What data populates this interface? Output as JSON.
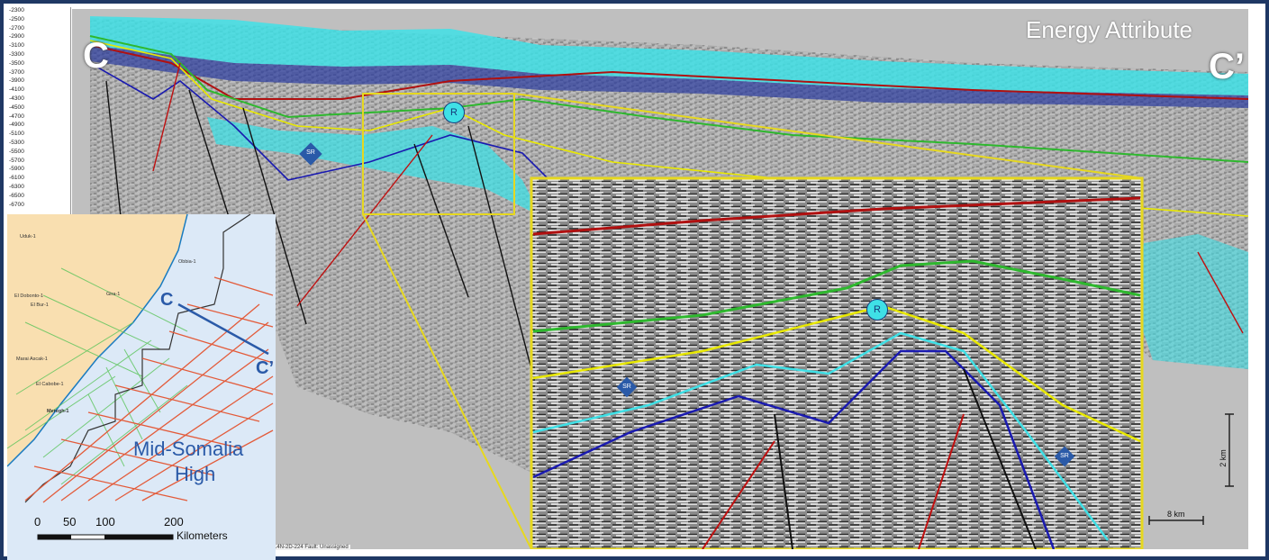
{
  "title": "Energy Attribute",
  "section_labels": {
    "start": "C",
    "end": "C’"
  },
  "markers": {
    "reflector": "R",
    "source_rock": "SR"
  },
  "depth_axis": {
    "ticks": [
      "-2300",
      "-2500",
      "-2700",
      "-2900",
      "-3100",
      "-3300",
      "-3500",
      "-3700",
      "-3900",
      "-4100",
      "-4300",
      "-4500",
      "-4700",
      "-4900",
      "-5100",
      "-5300",
      "-5500",
      "-5700",
      "-5900",
      "-6100",
      "-6300",
      "-6500",
      "-6700"
    ]
  },
  "status_text": "14N-2D-224   Fault: Unassigned",
  "scale": {
    "vertical": "2 km",
    "horizontal": "8 km"
  },
  "map": {
    "region_label_line1": "Mid-Somalia",
    "region_label_line2": "High",
    "line_start": "C",
    "line_end": "C’",
    "wells": [
      "Uduk-1",
      "Obbia-1",
      "El Dobonto-1",
      "El Bur-1",
      "Gira-1",
      "Marai Ascak-1",
      "El Cabobe-1",
      "Meregh-1"
    ],
    "scale_ticks": [
      "0",
      "50",
      "100",
      "200"
    ],
    "scale_unit": "Kilometers"
  },
  "colors": {
    "frame": "#1f3864",
    "cyan": "#3fe0e6",
    "horizon_red": "#b01010",
    "horizon_green": "#2eb82e",
    "horizon_yellow": "#e8e800",
    "horizon_blue": "#1a1ab0",
    "inset_border": "#e6d81f"
  }
}
